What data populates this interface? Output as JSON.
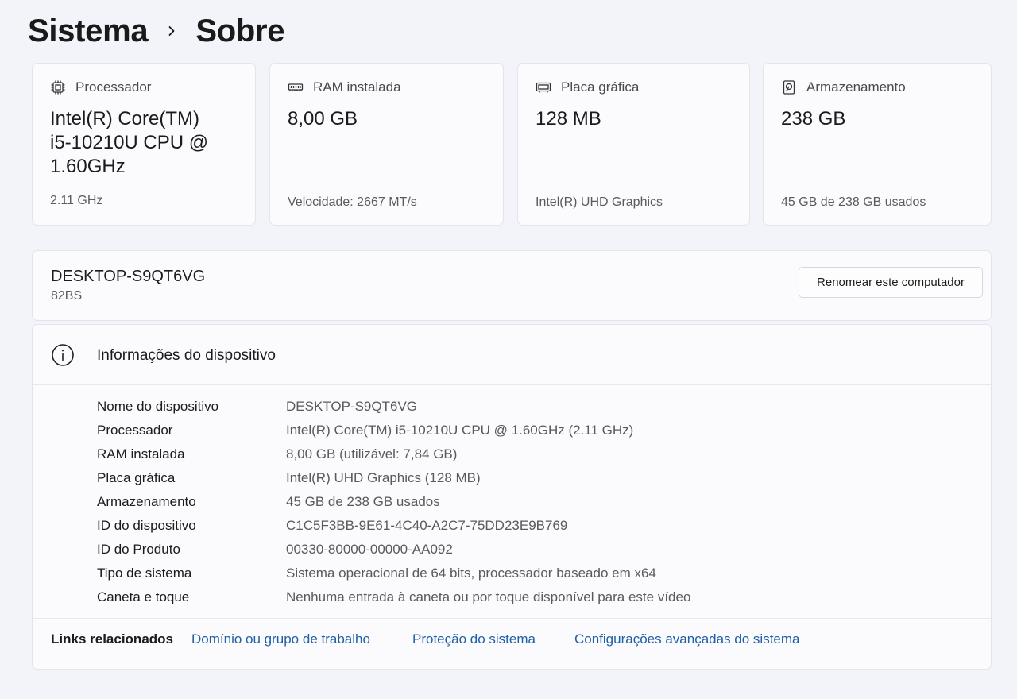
{
  "breadcrumb": {
    "parent": "Sistema",
    "current": "Sobre"
  },
  "cards": [
    {
      "icon": "processor-chip-icon",
      "label": "Processador",
      "value": "Intel(R) Core(TM) i5-10210U CPU @ 1.60GHz",
      "sub": "2.11 GHz"
    },
    {
      "icon": "ram-module-icon",
      "label": "RAM instalada",
      "value": "8,00 GB",
      "sub": "Velocidade: 2667 MT/s"
    },
    {
      "icon": "graphics-card-icon",
      "label": "Placa gráfica",
      "value": "128 MB",
      "sub": "Intel(R) UHD Graphics"
    },
    {
      "icon": "storage-drive-icon",
      "label": "Armazenamento",
      "value": "238 GB",
      "sub": "45 GB de 238 GB usados"
    }
  ],
  "computer": {
    "name": "DESKTOP-S9QT6VG",
    "model": "82BS",
    "rename_label": "Renomear este computador"
  },
  "device_info": {
    "title": "Informações do dispositivo",
    "rows": [
      {
        "label": "Nome do dispositivo",
        "value": "DESKTOP-S9QT6VG"
      },
      {
        "label": "Processador",
        "value": "Intel(R) Core(TM) i5-10210U CPU @ 1.60GHz (2.11 GHz)"
      },
      {
        "label": "RAM instalada",
        "value": "8,00 GB (utilizável: 7,84 GB)"
      },
      {
        "label": "Placa gráfica",
        "value": "Intel(R) UHD Graphics (128 MB)"
      },
      {
        "label": "Armazenamento",
        "value": "45 GB de 238 GB usados"
      },
      {
        "label": "ID do dispositivo",
        "value": "C1C5F3BB-9E61-4C40-A2C7-75DD23E9B769"
      },
      {
        "label": "ID do Produto",
        "value": "00330-80000-00000-AA092"
      },
      {
        "label": "Tipo de sistema",
        "value": "Sistema operacional de 64 bits, processador baseado em x64"
      },
      {
        "label": "Caneta e toque",
        "value": "Nenhuma entrada à caneta ou por toque disponível para este vídeo"
      }
    ]
  },
  "related_links": {
    "label": "Links relacionados",
    "items": [
      {
        "label": "Domínio ou grupo de trabalho"
      },
      {
        "label": "Proteção do sistema"
      },
      {
        "label": "Configurações avançadas do sistema"
      }
    ]
  },
  "colors": {
    "accent_link": "#1f5fa8",
    "background": "#f3f4f9",
    "card": "#fbfbfd"
  }
}
